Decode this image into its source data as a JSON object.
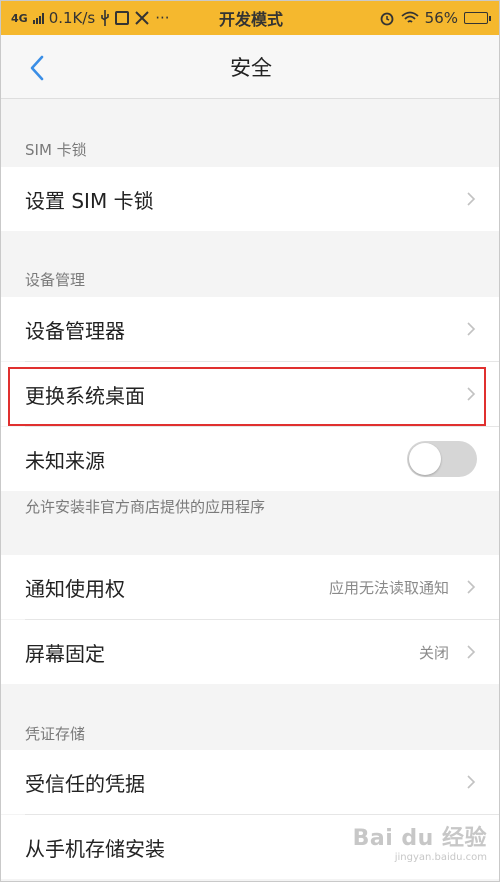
{
  "status_bar": {
    "network": "4G",
    "speed": "0.1K/s",
    "title": "开发模式",
    "battery": "56%",
    "battery_level": 0.56,
    "more": "···"
  },
  "nav": {
    "title": "安全"
  },
  "sections": {
    "sim": {
      "label": "SIM 卡锁",
      "items": [
        {
          "label": "设置 SIM 卡锁"
        }
      ]
    },
    "device": {
      "label": "设备管理",
      "items": [
        {
          "label": "设备管理器"
        },
        {
          "label": "更换系统桌面"
        },
        {
          "label": "未知来源",
          "toggle": false
        }
      ],
      "description": "允许安装非官方商店提供的应用程序"
    },
    "other": {
      "items": [
        {
          "label": "通知使用权",
          "value": "应用无法读取通知"
        },
        {
          "label": "屏幕固定",
          "value": "关闭"
        }
      ]
    },
    "credentials": {
      "label": "凭证存储",
      "items": [
        {
          "label": "受信任的凭据"
        },
        {
          "label": "从手机存储安装"
        }
      ]
    }
  },
  "colors": {
    "status_bar": "#f5b82e",
    "accent": "#3a8ee6",
    "highlight": "#e0302f"
  },
  "watermark": {
    "logo": "Bai du 经验",
    "url": "jingyan.baidu.com"
  }
}
